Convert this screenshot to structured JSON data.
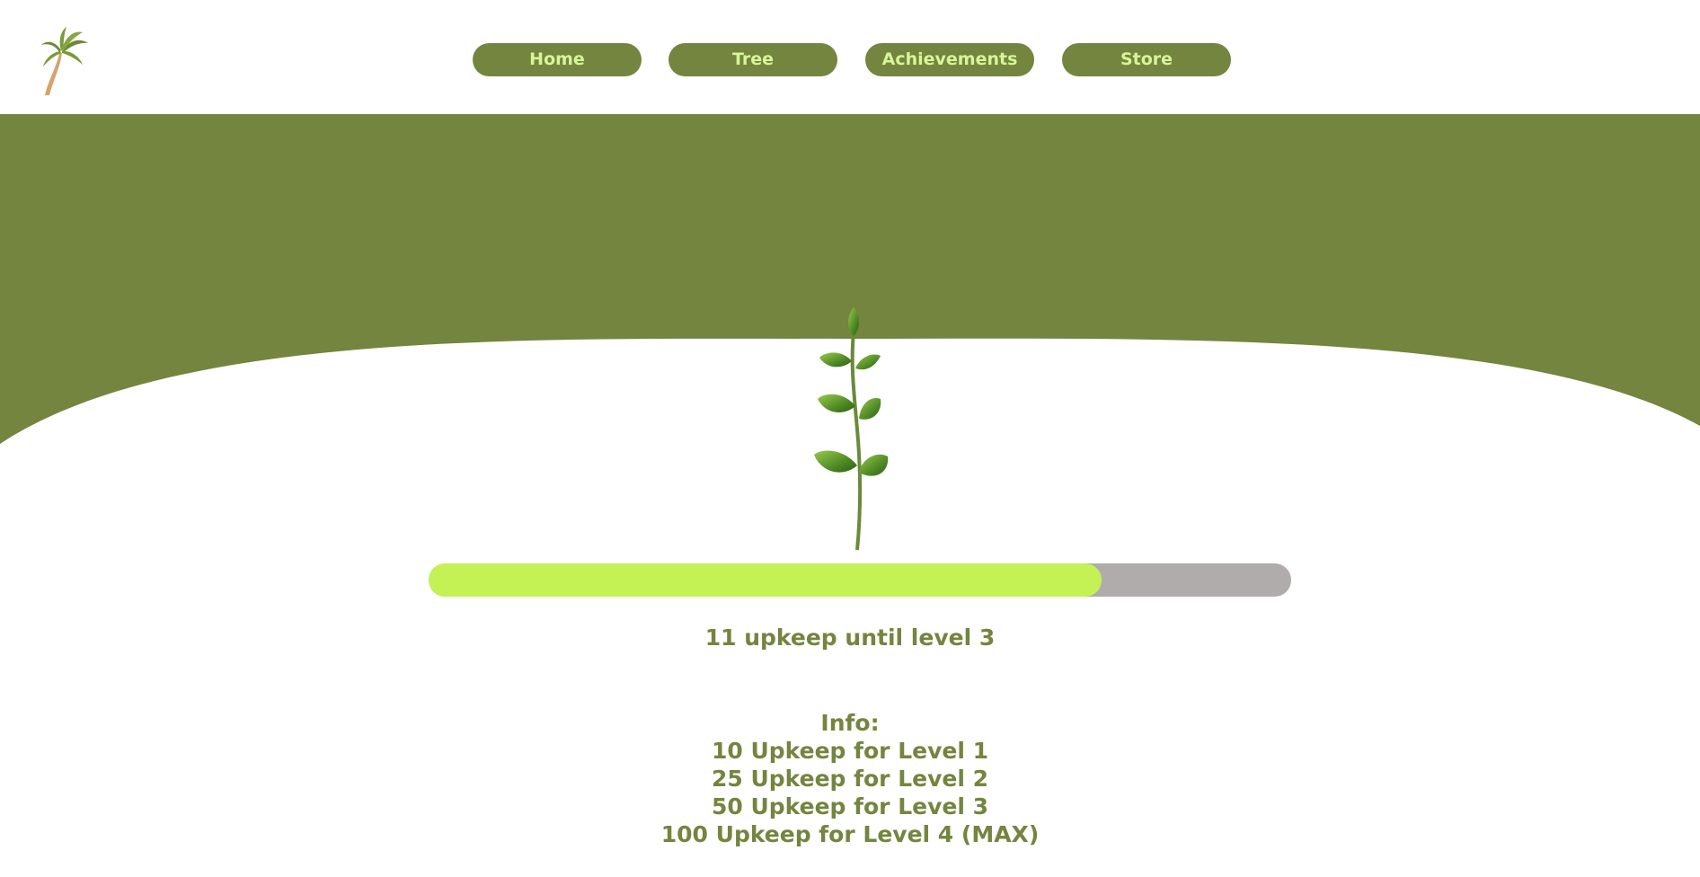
{
  "nav": {
    "items": [
      {
        "label": "Home"
      },
      {
        "label": "Tree"
      },
      {
        "label": "Achievements"
      },
      {
        "label": "Store"
      }
    ]
  },
  "colors": {
    "primary_green": "#73853f",
    "nav_text": "#d8f59a",
    "progress_fill": "#c4f255",
    "progress_track": "#b1acac",
    "background": "#ffffff"
  },
  "icons": {
    "logo": "palm-tree-icon",
    "plant": "sapling-icon"
  },
  "progress": {
    "fraction": 0.78,
    "status_text": "11 upkeep until level 3"
  },
  "info": {
    "heading": "Info:",
    "levels": [
      "10 Upkeep for Level 1",
      "25 Upkeep for Level 2",
      "50 Upkeep for Level 3",
      "100 Upkeep for Level 4 (MAX)"
    ]
  }
}
